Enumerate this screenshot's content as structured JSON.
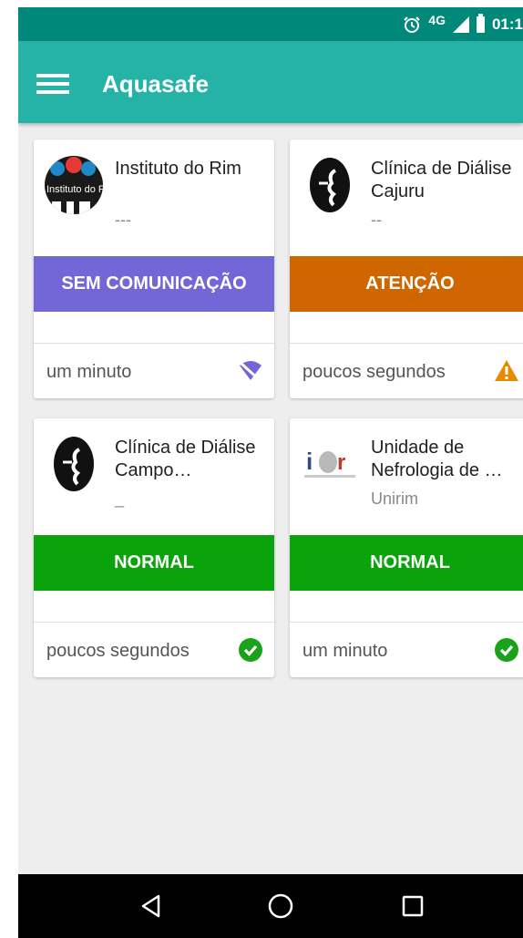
{
  "status_bar": {
    "network": "4G",
    "time": "01:1"
  },
  "app_bar": {
    "title": "Aquasafe"
  },
  "cards": [
    {
      "name": "Instituto do Rim",
      "subtitle": "---",
      "status": "SEM COMUNICAÇÃO",
      "status_color": "#7366d6",
      "updated": "um minuto",
      "status_icon": "wifi-off-icon",
      "logo_icon": "instituto-do-rim-logo",
      "logo_text": "Instituto do Rim"
    },
    {
      "name": "Clínica de Diálise Cajuru",
      "subtitle": "--",
      "status": "ATENÇÃO",
      "status_color": "#d06600",
      "updated": "poucos segundos",
      "status_icon": "warning-icon",
      "logo_icon": "kidney-logo"
    },
    {
      "name": "Clínica de Diálise Campo…",
      "subtitle": "_",
      "status": "NORMAL",
      "status_color": "#0ba30b",
      "updated": "poucos segundos",
      "status_icon": "check-circle-icon",
      "logo_icon": "kidney-logo"
    },
    {
      "name": "Unidade de Nefrologia de …",
      "subtitle": "Unirim",
      "status": "NORMAL",
      "status_color": "#0ba30b",
      "updated": "um minuto",
      "status_icon": "check-circle-icon",
      "logo_icon": "icr-logo"
    }
  ],
  "colors": {
    "status_bar": "#00897b",
    "app_bar": "#26b3a7",
    "warning": "#e68a00",
    "ok": "#1aa31a",
    "offline": "#7366d6"
  }
}
